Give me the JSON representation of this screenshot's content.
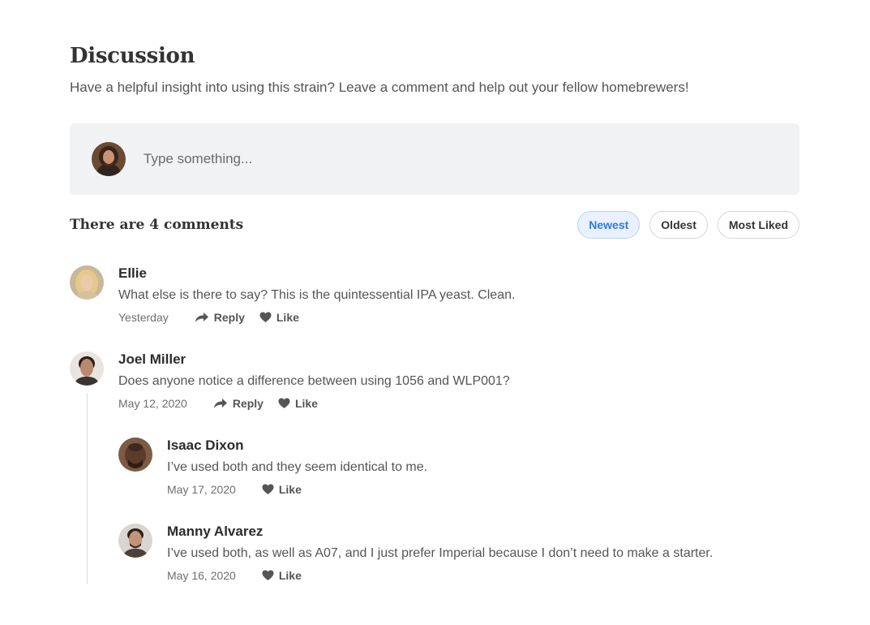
{
  "header": {
    "title": "Discussion",
    "subtitle": "Have a helpful insight into using this strain? Leave a comment and help out your fellow homebrewers!"
  },
  "composer": {
    "placeholder": "Type something..."
  },
  "comments_header": {
    "count_text": "There are 4 comments",
    "sort_options": [
      "Newest",
      "Oldest",
      "Most Liked"
    ],
    "selected_sort": "Newest"
  },
  "comments": [
    {
      "author": "Ellie",
      "text": "What else is there to say? This is the quintessential IPA yeast. Clean.",
      "date": "Yesterday",
      "reply_label": "Reply",
      "like_label": "Like"
    },
    {
      "author": "Joel Miller",
      "text": "Does anyone notice a difference between using 1056 and WLP001?",
      "date": "May 12, 2020",
      "reply_label": "Reply",
      "like_label": "Like",
      "replies": [
        {
          "author": "Isaac Dixon",
          "text": "I’ve used both and they seem identical to me.",
          "date": "May 17, 2020",
          "like_label": "Like"
        },
        {
          "author": "Manny Alvarez",
          "text": "I’ve used both, as well as A07, and I just prefer Imperial because I don’t need to make a starter.",
          "date": "May 16, 2020",
          "like_label": "Like"
        }
      ]
    }
  ],
  "colors": {
    "accent": "#2d7be0",
    "accent_bg": "#e8f1fd",
    "composer_bg": "#f1f2f4"
  }
}
